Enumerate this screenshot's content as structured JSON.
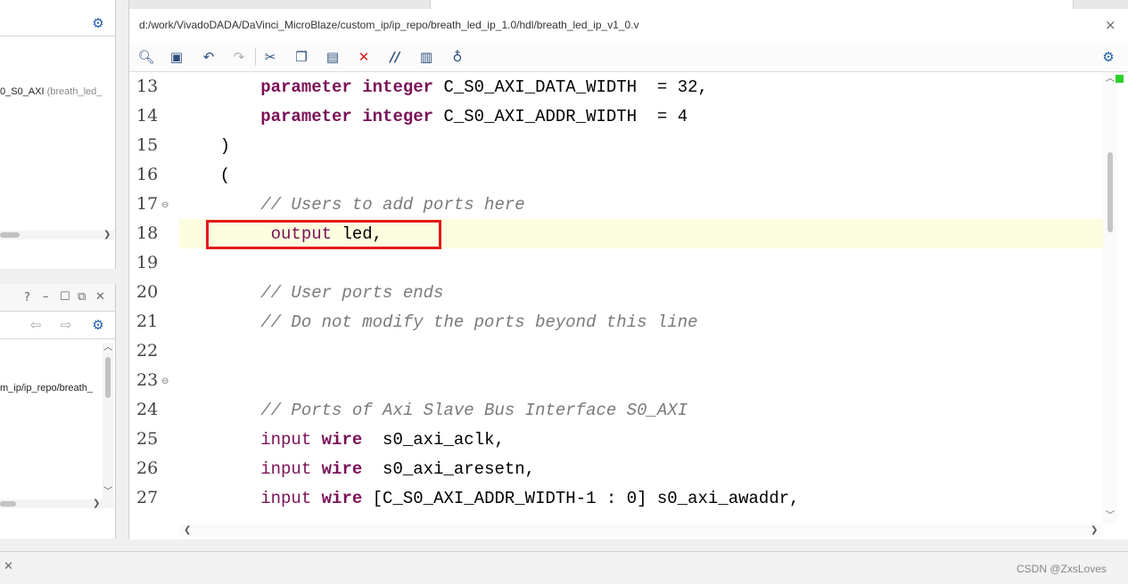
{
  "left_panel_top": {
    "item_text": "0_S0_AXI",
    "item_hint": "(breath_led_"
  },
  "left_panel_bottom": {
    "item_text": "m_ip/ip_repo/breath_"
  },
  "editor": {
    "file_path": "d:/work/VivadoDADA/DaVinci_MicroBlaze/custom_ip/ip_repo/breath_led_ip_1.0/hdl/breath_led_ip_v1_0.v",
    "close_glyph": "×",
    "toolbar_icons": [
      "search-icon",
      "save-icon",
      "undo-icon",
      "redo-icon",
      "cut-icon",
      "copy-icon",
      "paste-icon",
      "delete-icon",
      "comment-icon",
      "columns-icon",
      "bulb-icon"
    ],
    "highlighted_line": 18,
    "line_numbers": [
      "13",
      "14",
      "15",
      "16",
      "17",
      "18",
      "19",
      "20",
      "21",
      "22",
      "23",
      "24",
      "25",
      "26",
      "27"
    ],
    "lines": [
      {
        "indent": "        ",
        "parts": [
          {
            "t": "parameter",
            "c": "kw"
          },
          {
            "t": " ",
            "c": ""
          },
          {
            "t": "integer",
            "c": "kw"
          },
          {
            "t": " C_S0_AXI_DATA_WIDTH  = 32,",
            "c": ""
          }
        ]
      },
      {
        "indent": "        ",
        "parts": [
          {
            "t": "parameter",
            "c": "kw"
          },
          {
            "t": " ",
            "c": ""
          },
          {
            "t": "integer",
            "c": "kw"
          },
          {
            "t": " C_S0_AXI_ADDR_WIDTH  = 4",
            "c": ""
          }
        ]
      },
      {
        "indent": "    ",
        "parts": [
          {
            "t": ")",
            "c": ""
          }
        ]
      },
      {
        "indent": "    ",
        "parts": [
          {
            "t": "(",
            "c": ""
          }
        ]
      },
      {
        "indent": "        ",
        "parts": [
          {
            "t": "// Users to add ports here",
            "c": "cm"
          }
        ]
      },
      {
        "indent": "         ",
        "parts": [
          {
            "t": "output",
            "c": "kwn"
          },
          {
            "t": " led,",
            "c": ""
          }
        ]
      },
      {
        "indent": "",
        "parts": []
      },
      {
        "indent": "        ",
        "parts": [
          {
            "t": "// User ports ends",
            "c": "cm"
          }
        ]
      },
      {
        "indent": "        ",
        "parts": [
          {
            "t": "// Do not modify the ports beyond this line",
            "c": "cm"
          }
        ]
      },
      {
        "indent": "",
        "parts": []
      },
      {
        "indent": "",
        "parts": []
      },
      {
        "indent": "        ",
        "parts": [
          {
            "t": "// Ports of Axi Slave Bus Interface S0_AXI",
            "c": "cm"
          }
        ]
      },
      {
        "indent": "        ",
        "parts": [
          {
            "t": "input",
            "c": "kwn"
          },
          {
            "t": " ",
            "c": ""
          },
          {
            "t": "wire",
            "c": "kw"
          },
          {
            "t": "  s0_axi_aclk,",
            "c": ""
          }
        ]
      },
      {
        "indent": "        ",
        "parts": [
          {
            "t": "input",
            "c": "kwn"
          },
          {
            "t": " ",
            "c": ""
          },
          {
            "t": "wire",
            "c": "kw"
          },
          {
            "t": "  s0_axi_aresetn,",
            "c": ""
          }
        ]
      },
      {
        "indent": "        ",
        "parts": [
          {
            "t": "input",
            "c": "kwn"
          },
          {
            "t": " ",
            "c": ""
          },
          {
            "t": "wire",
            "c": "kw"
          },
          {
            "t": " [C_S0_AXI_ADDR_WIDTH-1 : 0] s0_axi_awaddr,",
            "c": ""
          }
        ]
      }
    ]
  },
  "watermark": "CSDN @ZxsLoves",
  "colors": {
    "keyword": "#7a1257",
    "comment": "#7a7a7a",
    "highlight": "#fcfcdf",
    "redbox": "#e21b1b",
    "icon_blue": "#1f5fa6"
  }
}
